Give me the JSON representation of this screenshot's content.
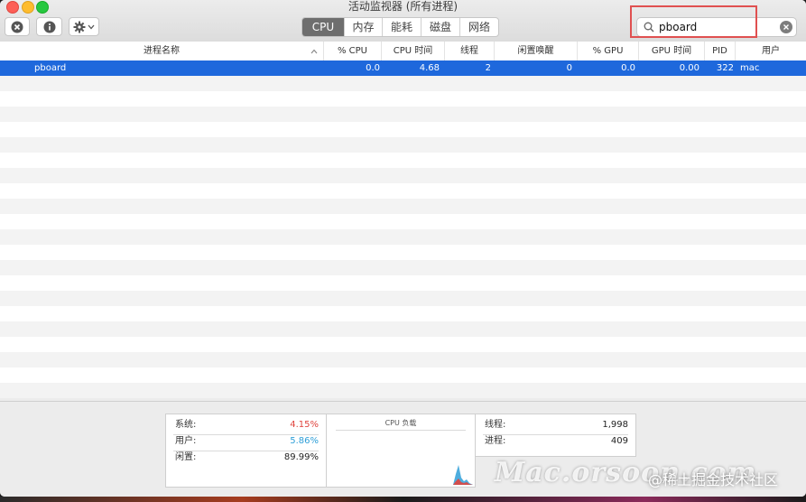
{
  "window": {
    "title": "活动监视器 (所有进程)"
  },
  "toolbar": {
    "close_process_icon": "stop-icon",
    "info_icon": "info-icon",
    "gear_icon": "gear-icon",
    "tabs": [
      {
        "label": "CPU",
        "active": true
      },
      {
        "label": "内存",
        "active": false
      },
      {
        "label": "能耗",
        "active": false
      },
      {
        "label": "磁盘",
        "active": false
      },
      {
        "label": "网络",
        "active": false
      }
    ],
    "search": {
      "value": "pboard",
      "placeholder": ""
    }
  },
  "table": {
    "columns": [
      "进程名称",
      "% CPU",
      "CPU 时间",
      "线程",
      "闲置唤醒",
      "% GPU",
      "GPU 时间",
      "PID",
      "用户"
    ],
    "rows": [
      {
        "name": "pboard",
        "cpu": "0.0",
        "cpu_time": "4.68",
        "threads": "2",
        "idle_wakeups": "0",
        "gpu": "0.0",
        "gpu_time": "0.00",
        "pid": "322",
        "user": "mac"
      }
    ]
  },
  "summary": {
    "system_label": "系统:",
    "system_value": "4.15%",
    "user_label": "用户:",
    "user_value": "5.86%",
    "idle_label": "闲置:",
    "idle_value": "89.99%",
    "cpu_load_title": "CPU 负载",
    "threads_label": "线程:",
    "threads_value": "1,998",
    "processes_label": "进程:",
    "processes_value": "409"
  },
  "colors": {
    "system": "#e0443e",
    "user": "#2f9fd8",
    "selection": "#1e68dc"
  },
  "watermark": {
    "brand": "Mac.orsoon.com",
    "community": "@稀土掘金技术社区"
  }
}
